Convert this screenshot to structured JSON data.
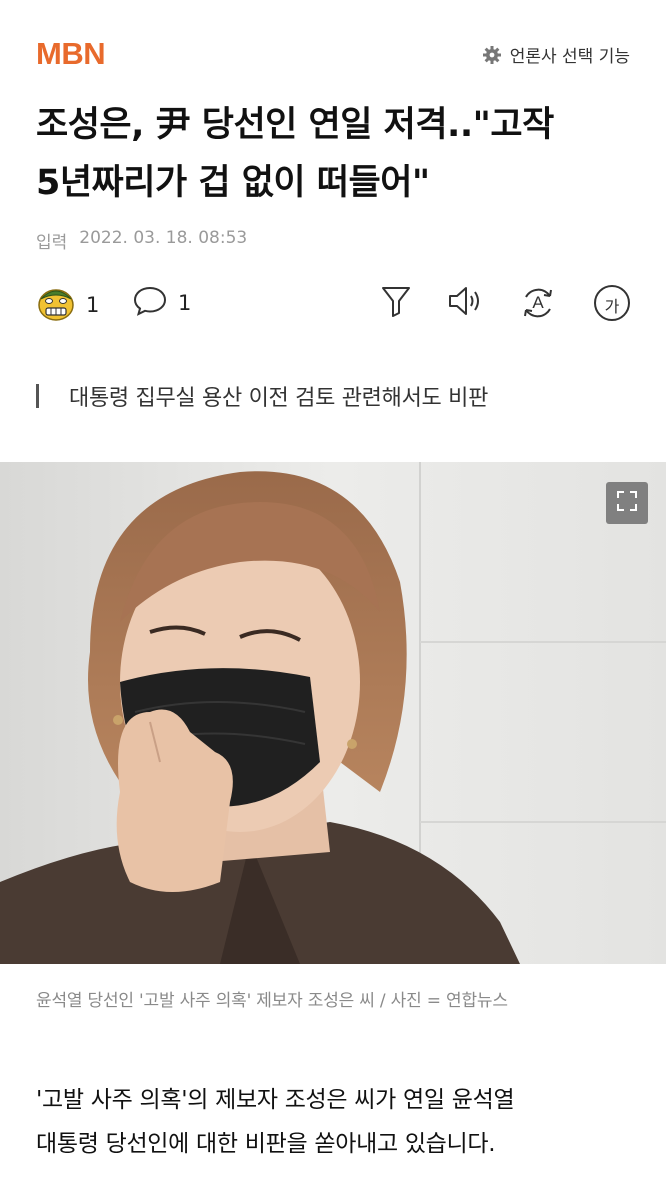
{
  "header": {
    "logo": "MBN",
    "press_select_label": "언론사 선택 기능"
  },
  "article": {
    "headline_line1": "조성은, 尹 당선인 연일 저격..\"고작",
    "headline_line2": "5년짜리가 겁 없이 떠들어\"",
    "date_label": "입력",
    "date_value": "2022. 03. 18. 08:53",
    "reaction_count": "1",
    "comment_count": "1",
    "subtitle": "대통령 집무실 용산 이전 검토 관련해서도 비판",
    "photo_caption": "윤석열 당선인 '고발 사주 의혹' 제보자 조성은 씨 / 사진 = 연합뉴스",
    "body_line1": "'고발 사주 의혹'의 제보자 조성은 씨가 연일 윤석열",
    "body_line2": "대통령 당선인에 대한 비판을 쏟아내고 있습니다."
  },
  "toolbar": {
    "icons": [
      "emoji-reaction-icon",
      "comment-icon",
      "filter-icon",
      "speaker-icon",
      "translate-icon",
      "font-size-icon"
    ],
    "font_size_glyph": "가",
    "translate_glyph": "A"
  },
  "colors": {
    "brand": "#e86a2c",
    "text": "#111111",
    "muted": "#9a9a9a"
  }
}
